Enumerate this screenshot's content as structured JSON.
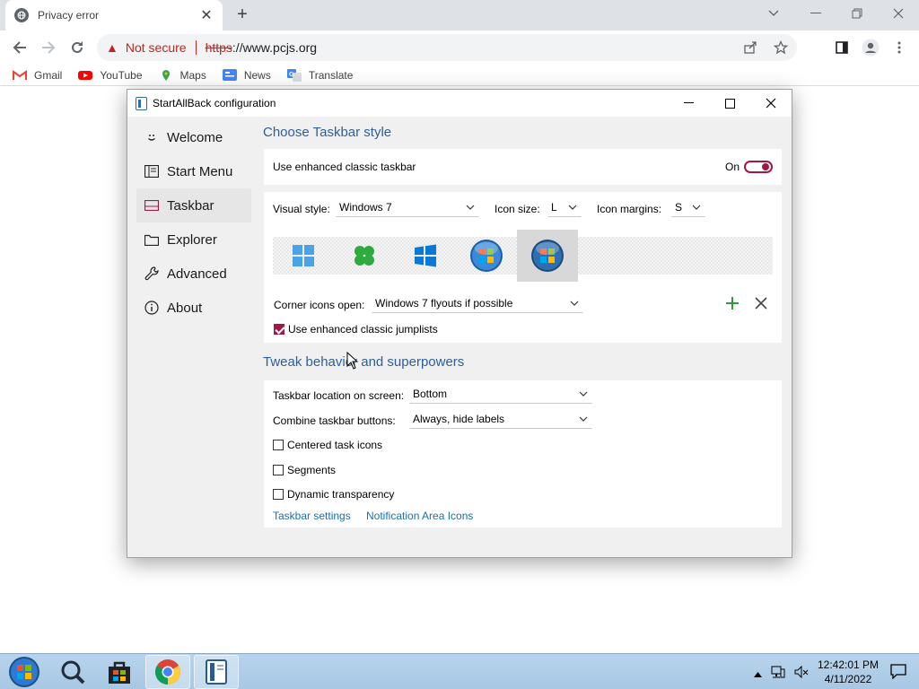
{
  "browser": {
    "tab_title": "Privacy error",
    "security_label": "Not secure",
    "url_protocol": "https",
    "url_rest": "://www.pcjs.org",
    "bookmarks": [
      {
        "label": "Gmail",
        "icon": "gmail-icon"
      },
      {
        "label": "YouTube",
        "icon": "youtube-icon"
      },
      {
        "label": "Maps",
        "icon": "maps-icon"
      },
      {
        "label": "News",
        "icon": "news-icon"
      },
      {
        "label": "Translate",
        "icon": "translate-icon"
      }
    ]
  },
  "dialog": {
    "title": "StartAllBack configuration",
    "sidebar": [
      {
        "label": "Welcome",
        "icon": "smiley-icon"
      },
      {
        "label": "Start Menu",
        "icon": "start-menu-icon"
      },
      {
        "label": "Taskbar",
        "icon": "taskbar-icon",
        "active": true
      },
      {
        "label": "Explorer",
        "icon": "folder-icon"
      },
      {
        "label": "Advanced",
        "icon": "wrench-icon"
      },
      {
        "label": "About",
        "icon": "info-icon"
      }
    ],
    "taskbar_style": {
      "heading": "Choose Taskbar style",
      "enhanced_label": "Use enhanced classic taskbar",
      "enhanced_state": "On",
      "visual_style_label": "Visual style:",
      "visual_style_value": "Windows 7",
      "icon_size_label": "Icon size:",
      "icon_size_value": "L",
      "icon_margins_label": "Icon margins:",
      "icon_margins_value": "S",
      "corner_icons_label": "Corner icons open:",
      "corner_icons_value": "Windows 7 flyouts if possible",
      "jumplists_label": "Use enhanced classic jumplists",
      "jumplists_checked": true
    },
    "tweak": {
      "heading": "Tweak behavior and superpowers",
      "location_label": "Taskbar location on screen:",
      "location_value": "Bottom",
      "combine_label": "Combine taskbar buttons:",
      "combine_value": "Always, hide labels",
      "centered_label": "Centered task icons",
      "segments_label": "Segments",
      "transparency_label": "Dynamic transparency",
      "link_taskbar_settings": "Taskbar settings",
      "link_notification_icons": "Notification Area Icons"
    }
  },
  "taskbar": {
    "time": "12:42:01 PM",
    "date": "4/11/2022"
  },
  "colors": {
    "accent": "#a01848",
    "heading": "#2e5f96",
    "link": "#1a6fb0",
    "danger": "#c5221f"
  }
}
